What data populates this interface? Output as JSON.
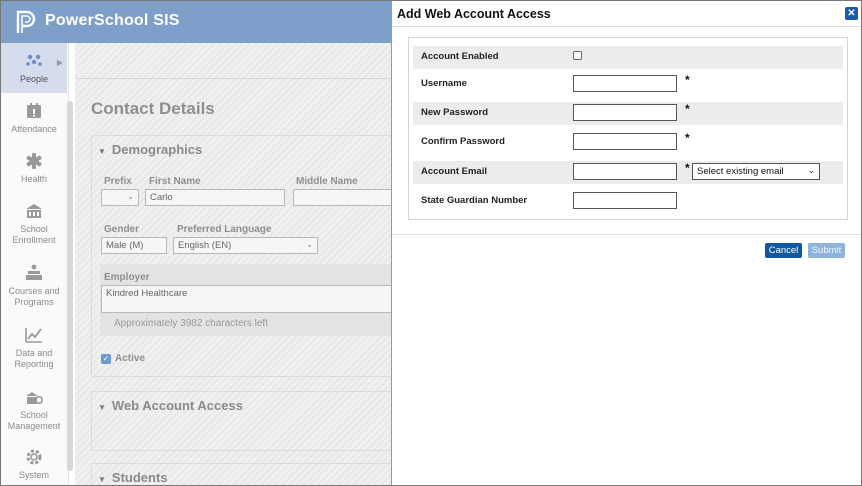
{
  "app": {
    "title": "PowerSchool SIS"
  },
  "nav": [
    {
      "label": "People",
      "icon": "people-icon"
    },
    {
      "label": "Attendance",
      "icon": "attendance-icon"
    },
    {
      "label": "Health",
      "icon": "health-icon"
    },
    {
      "label": "School Enrollment",
      "icon": "school-enrollment-icon"
    },
    {
      "label": "Courses and Programs",
      "icon": "courses-icon"
    },
    {
      "label": "Data and Reporting",
      "icon": "data-reporting-icon"
    },
    {
      "label": "School Management",
      "icon": "school-management-icon"
    },
    {
      "label": "System",
      "icon": "system-icon"
    }
  ],
  "page": {
    "title": "Contact Details",
    "demographics": {
      "heading": "Demographics",
      "prefix_label": "Prefix",
      "first_name_label": "First Name",
      "first_name_value": "Carlo",
      "middle_name_label": "Middle Name",
      "gender_label": "Gender",
      "gender_value": "Male (M)",
      "language_label": "Preferred Language",
      "language_value": "English (EN)",
      "employer_label": "Employer",
      "employer_value": "Kindred Healthcare",
      "chars_left": "Approximately 3982 characters left",
      "active_label": "Active"
    },
    "web_access_heading": "Web Account Access",
    "students_heading": "Students"
  },
  "modal": {
    "title": "Add Web Account Access",
    "fields": {
      "account_enabled": "Account Enabled",
      "username": "Username",
      "new_password": "New Password",
      "confirm_password": "Confirm Password",
      "account_email": "Account Email",
      "state_guardian_number": "State Guardian Number"
    },
    "required_mark": "*",
    "email_select": "Select existing email",
    "cancel": "Cancel",
    "submit": "Submit"
  },
  "colors": {
    "header": "#7d9fca",
    "primary_button": "#0f5a9e",
    "disabled_button": "#8fb4dc"
  }
}
